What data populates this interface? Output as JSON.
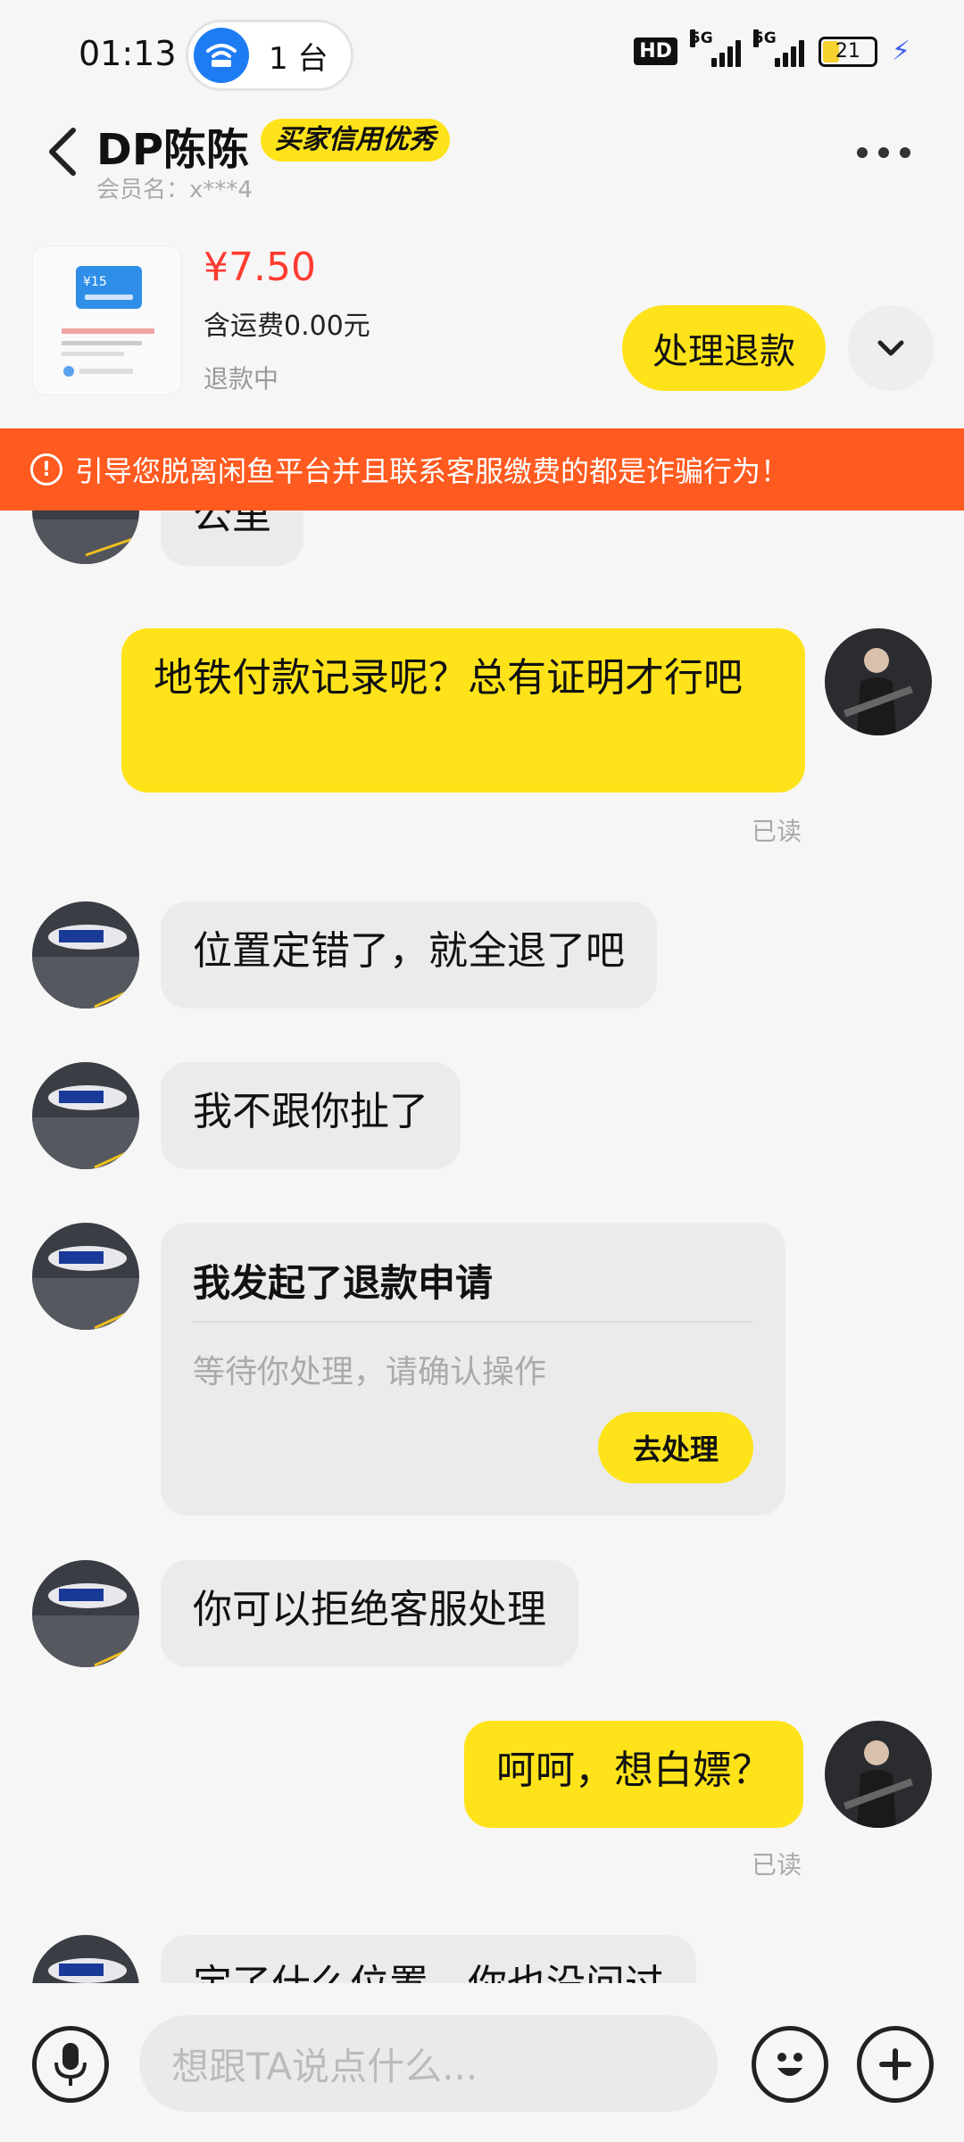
{
  "status_bar": {
    "time": "01:13",
    "wifi_device_count": "1 台",
    "hd_label": "HD",
    "network_1": "5G",
    "network_2": "5G",
    "battery": "21"
  },
  "header": {
    "name": "DP陈陈",
    "badge": "买家信用优秀",
    "member_label": "会员名：x***4"
  },
  "product": {
    "price": "¥7.50",
    "shipping": "含运费0.00元",
    "status": "退款中",
    "refund_button": "处理退款"
  },
  "warning": "引导您脱离闲鱼平台并且联系客服缴费的都是诈骗行为！",
  "messages": [
    {
      "side": "in",
      "text": "公里"
    },
    {
      "side": "out",
      "text": "地铁付款记录呢？总有证明才行吧",
      "status": "已读"
    },
    {
      "side": "in",
      "text": "位置定错了，就全退了吧"
    },
    {
      "side": "in",
      "text": "我不跟你扯了"
    },
    {
      "side": "in",
      "type": "card",
      "title": "我发起了退款申请",
      "subtitle": "等待你处理，请确认操作",
      "button": "去处理"
    },
    {
      "side": "in",
      "text": "你可以拒绝客服处理"
    },
    {
      "side": "out",
      "text": "呵呵，想白嫖？",
      "status": "已读"
    },
    {
      "side": "in",
      "text": "定了什么位置，你也没问过"
    }
  ],
  "input": {
    "placeholder": "想跟TA说点什么..."
  },
  "colors": {
    "accent": "#ffe31a",
    "warning": "#ff5a1f",
    "price": "#ff3b30",
    "incoming_bubble": "#ebebeb"
  }
}
